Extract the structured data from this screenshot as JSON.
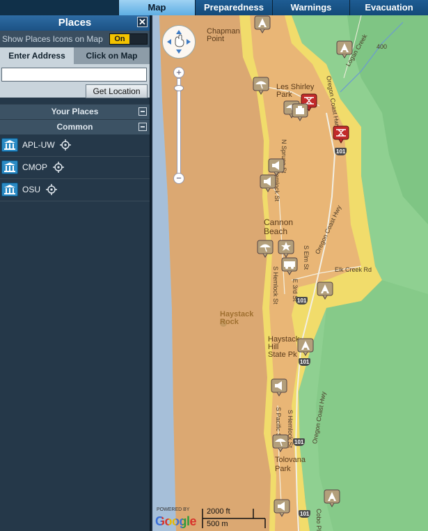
{
  "nav": {
    "tabs": [
      {
        "label": "Map",
        "active": true
      },
      {
        "label": "Preparedness",
        "active": false
      },
      {
        "label": "Warnings",
        "active": false
      },
      {
        "label": "Evacuation",
        "active": false
      }
    ]
  },
  "sidebar": {
    "title": "Places",
    "close_symbol": "✕",
    "show_icons_label": "Show Places Icons on Map",
    "show_icons_toggle": "On",
    "address_tabs": [
      "Enter Address",
      "Click on Map"
    ],
    "address_input_value": "",
    "get_location_label": "Get Location",
    "your_places_label": "Your Places",
    "common_label": "Common",
    "places": [
      "APL-UW",
      "CMOP",
      "OSU"
    ]
  },
  "map": {
    "labels": {
      "chapman_point": "Chapman\nPoint",
      "les_shirley_park": "Les Shirley\nPark",
      "cannon_beach": "Cannon\nBeach",
      "haystack_rock": "Haystack\nRock",
      "haystack_hill": "Haystack\nHill\nState Pk",
      "tolovana_park": "Tolovana\nPark",
      "logan_creek": "Logan Creek",
      "oregon_coast_hwy_1": "Oregon Coast Hwy",
      "oregon_coast_hwy_2": "Oregon Coast Hwy",
      "oregon_coast_hwy_3": "Oregon Coast Hwy",
      "n_spruce_st": "N Spruce St",
      "n_hemlock_st": "N Hemlock St",
      "s_hemlock_st": "S Hemlock St",
      "s_pacific_st": "S Pacific St",
      "s_hemlock_st_2": "S Hemlock St",
      "elk_creek_rd": "Elk Creek Rd",
      "e_3rd_st": "E 3rd St",
      "s_elm_st": "S Elm St",
      "elevation_400": "400",
      "cobo_pl": "Cobo Pl"
    },
    "shields": [
      "101",
      "101",
      "101",
      "101",
      "101"
    ],
    "scale_ft": "2000 ft",
    "scale_m": "500 m",
    "powered_by": "POWERED BY",
    "google": "Google",
    "colors": {
      "low": "#e7b274",
      "medium": "#f1dc6b",
      "high": "#8fd091",
      "ocean": "#a6bfd9",
      "beach": "#dba872",
      "hazard_marker": "#c22a2a"
    },
    "markers": [
      "assembly-point-marker",
      "beach-access-marker",
      "siren-marker",
      "police-marker",
      "fire-station-marker",
      "hospital-marker",
      "evacuation-route-marker"
    ]
  }
}
